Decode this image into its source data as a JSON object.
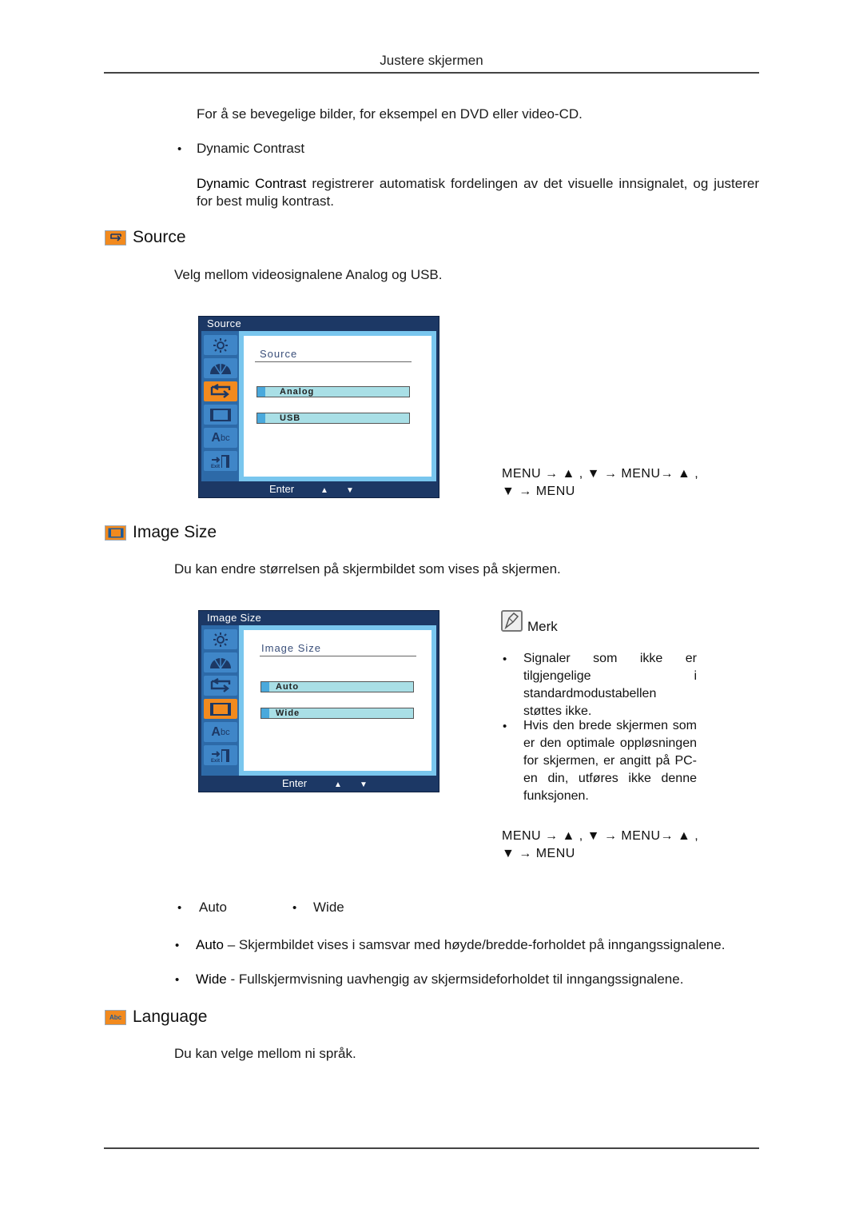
{
  "header": {
    "title": "Justere skjermen"
  },
  "intro": {
    "video_text": "For å se bevegelige bilder, for eksempel en DVD eller video-CD.",
    "dynamic_contrast_bullet": "Dynamic Contrast",
    "dynamic_contrast_term": "Dynamic Contrast",
    "dynamic_contrast_desc": " registrerer automatisk fordelingen av det visuelle innsignalet, og justerer for best mulig kontrast."
  },
  "bullet_char": "•",
  "source": {
    "title": "Source",
    "icon": "source-swap-icon",
    "description": "Velg mellom videosignalene Analog og USB.",
    "osd": {
      "window_title": "Source",
      "heading": "Source",
      "options": [
        "Analog",
        "USB"
      ],
      "footer": {
        "enter": "Enter",
        "up": "▲",
        "down": "▼"
      },
      "sidebar": [
        "brightness-icon",
        "color-gauge-icon",
        "source-swap-icon",
        "image-size-icon",
        "language-abc-icon",
        "exit-icon"
      ],
      "active_index": 2
    },
    "nav": {
      "line1": "MENU → ▲ , ▼ → MENU→ ▲ ,",
      "line2": "▼ → MENU"
    }
  },
  "image_size": {
    "title": "Image Size",
    "icon": "image-size-icon",
    "description": "Du kan endre størrelsen på skjermbildet som vises på skjermen.",
    "osd": {
      "window_title": "Image Size",
      "heading": "Image Size",
      "options": [
        "Auto",
        "Wide"
      ],
      "footer": {
        "enter": "Enter",
        "up": "▲",
        "down": "▼"
      },
      "active_index": 3
    },
    "note": {
      "title": "Merk",
      "items": [
        "Signaler som ikke er tilgjengelige i standardmodustabellen støttes ikke.",
        "Hvis den brede skjermen som er den optimale oppløsningen for skjermen, er angitt på PC-en din, utføres ikke denne funksjonen."
      ]
    },
    "nav": {
      "line1": "MENU → ▲ , ▼ → MENU→ ▲ ,",
      "line2": "▼ → MENU"
    },
    "option_bullets": [
      "Auto",
      "Wide"
    ],
    "details": [
      {
        "term": "Auto",
        "text": " – Skjermbildet vises i samsvar med høyde/bredde-forholdet på inngangssignalene."
      },
      {
        "term": "Wide",
        "text": " - Fullskjermvisning uavhengig av skjermsideforholdet til inngangssignalene."
      }
    ]
  },
  "language": {
    "title": "Language",
    "icon": "language-abc-icon",
    "description": "Du kan velge mellom ni språk."
  },
  "colors": {
    "accent_orange": "#f28a1e",
    "osd_navy": "#1c3865",
    "osd_blue": "#3f86c8",
    "osd_option": "#a9dfe6"
  }
}
